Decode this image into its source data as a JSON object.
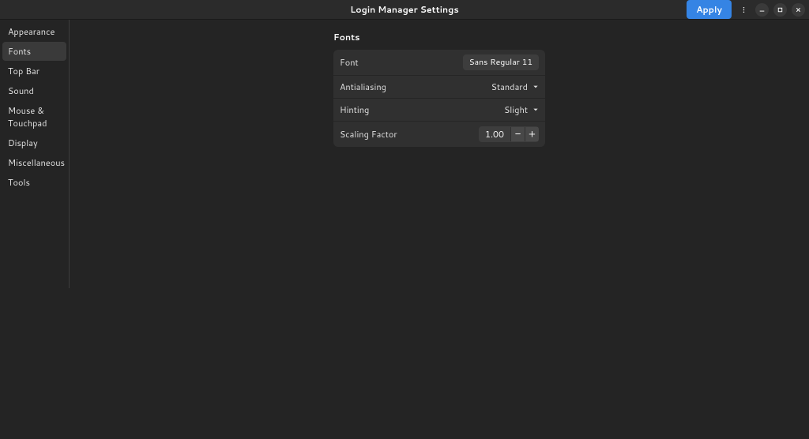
{
  "header": {
    "title": "Login Manager Settings",
    "apply_label": "Apply"
  },
  "sidebar": {
    "items": [
      {
        "label": "Appearance",
        "active": false
      },
      {
        "label": "Fonts",
        "active": true
      },
      {
        "label": "Top Bar",
        "active": false
      },
      {
        "label": "Sound",
        "active": false
      },
      {
        "label": "Mouse & Touchpad",
        "active": false
      },
      {
        "label": "Display",
        "active": false
      },
      {
        "label": "Miscellaneous",
        "active": false
      },
      {
        "label": "Tools",
        "active": false
      }
    ]
  },
  "panel": {
    "title": "Fonts",
    "rows": {
      "font": {
        "label": "Font",
        "value": "Sans Regular  11"
      },
      "antialiasing": {
        "label": "Antialiasing",
        "value": "Standard"
      },
      "hinting": {
        "label": "Hinting",
        "value": "Slight"
      },
      "scaling": {
        "label": "Scaling Factor",
        "value": "1.00"
      }
    }
  }
}
